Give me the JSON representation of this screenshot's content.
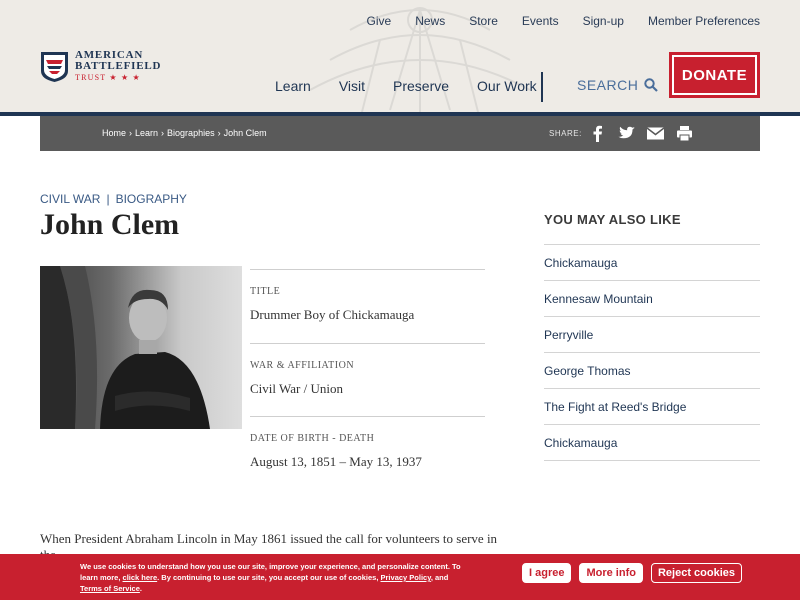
{
  "utility_nav": [
    "Give",
    "News",
    "Store",
    "Events",
    "Sign-up",
    "Member Preferences"
  ],
  "logo": {
    "line1": "AMERICAN",
    "line2": "BATTLEFIELD",
    "line3": "TRUST ★ ★ ★"
  },
  "main_nav": [
    "Learn",
    "Visit",
    "Preserve",
    "Our Work"
  ],
  "search_label": "SEARCH",
  "donate_label": "DONATE",
  "breadcrumb": [
    "Home",
    "›",
    "Learn",
    "›",
    "Biographies",
    "›",
    "John Clem"
  ],
  "share_label": "SHARE:",
  "categories": [
    "CIVIL WAR",
    "|",
    "BIOGRAPHY"
  ],
  "page_title": "John Clem",
  "facts": [
    {
      "label": "TITLE",
      "value": "Drummer Boy of Chickamauga"
    },
    {
      "label": "WAR & AFFILIATION",
      "value": "Civil War / Union"
    },
    {
      "label": "DATE OF BIRTH - DEATH",
      "value": "August 13, 1851 – May 13, 1937"
    }
  ],
  "body_text": "When President Abraham Lincoln in May 1861 issued the call for volunteers to serve in the",
  "sidebar": {
    "heading": "YOU MAY ALSO LIKE",
    "items": [
      "Chickamauga",
      "Kennesaw Mountain",
      "Perryville",
      "George Thomas",
      "The Fight at Reed's Bridge",
      "Chickamauga"
    ]
  },
  "cookie": {
    "text1": "We use cookies to understand how you use our site, improve your experience, and personalize content. To learn more, ",
    "link1": "click here",
    "text2": ". By continuing to use our site, you accept our use of cookies, ",
    "link2": "Privacy Policy",
    "text3": ", and ",
    "link3": "Terms of Service",
    "text4": ".",
    "agree": "I agree",
    "more": "More info",
    "reject": "Reject cookies"
  },
  "colors": {
    "brand_red": "#c8202f",
    "brand_navy": "#1f3553",
    "breadcrumb_bg": "#5a5a5a"
  }
}
